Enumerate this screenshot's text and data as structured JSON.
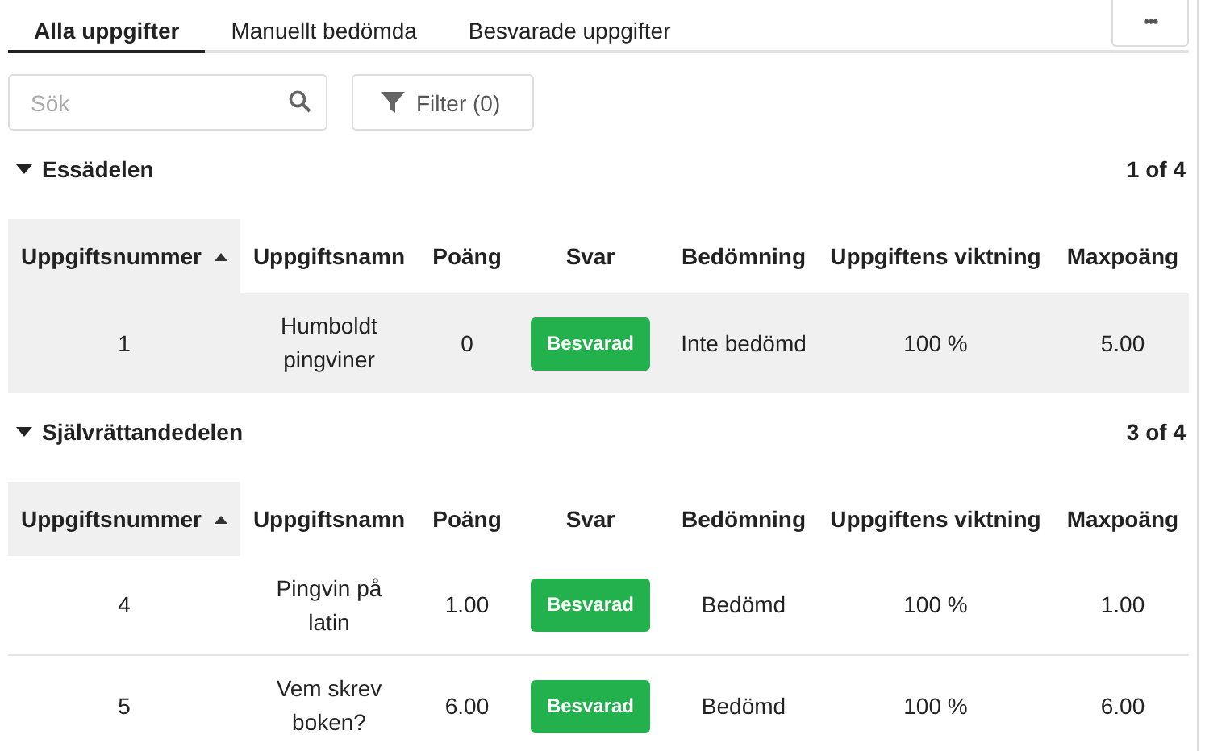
{
  "tabs": [
    {
      "label": "Alla uppgifter",
      "selected": true
    },
    {
      "label": "Manuellt bedömda",
      "selected": false
    },
    {
      "label": "Besvarade uppgifter",
      "selected": false
    }
  ],
  "more_button": {
    "label": "•••"
  },
  "search": {
    "placeholder": "Sök"
  },
  "filter_button": {
    "label": "Filter (0)"
  },
  "sections": [
    {
      "title": "Essädelen",
      "expanded": true,
      "count": "1 of 4",
      "columns": [
        {
          "label": "Uppgiftsnummer",
          "sorted": true
        },
        {
          "label": "Uppgiftsnamn",
          "sorted": false
        },
        {
          "label": "Poäng",
          "sorted": false
        },
        {
          "label": "Svar",
          "sorted": false
        },
        {
          "label": "Bedömning",
          "sorted": false
        },
        {
          "label": "Uppgiftens viktning",
          "sorted": false
        },
        {
          "label": "Maxpoäng",
          "sorted": false
        }
      ],
      "rows": [
        {
          "selected": true,
          "number": "1",
          "name": "Humboldt pingviner",
          "points": "0",
          "answer": "Besvarad",
          "grading": "Inte bedömd",
          "weight": "100 %",
          "max": "5.00"
        }
      ]
    },
    {
      "title": "Självrättandedelen",
      "expanded": true,
      "count": "3 of 4",
      "columns": [
        {
          "label": "Uppgiftsnummer",
          "sorted": true
        },
        {
          "label": "Uppgiftsnamn",
          "sorted": false
        },
        {
          "label": "Poäng",
          "sorted": false
        },
        {
          "label": "Svar",
          "sorted": false
        },
        {
          "label": "Bedömning",
          "sorted": false
        },
        {
          "label": "Uppgiftens viktning",
          "sorted": false
        },
        {
          "label": "Maxpoäng",
          "sorted": false
        }
      ],
      "rows": [
        {
          "selected": false,
          "number": "4",
          "name": "Pingvin på latin",
          "points": "1.00",
          "answer": "Besvarad",
          "grading": "Bedömd",
          "weight": "100 %",
          "max": "1.00"
        },
        {
          "selected": false,
          "number": "5",
          "name": "Vem skrev boken?",
          "points": "6.00",
          "answer": "Besvarad",
          "grading": "Bedömd",
          "weight": "100 %",
          "max": "6.00"
        }
      ]
    }
  ]
}
